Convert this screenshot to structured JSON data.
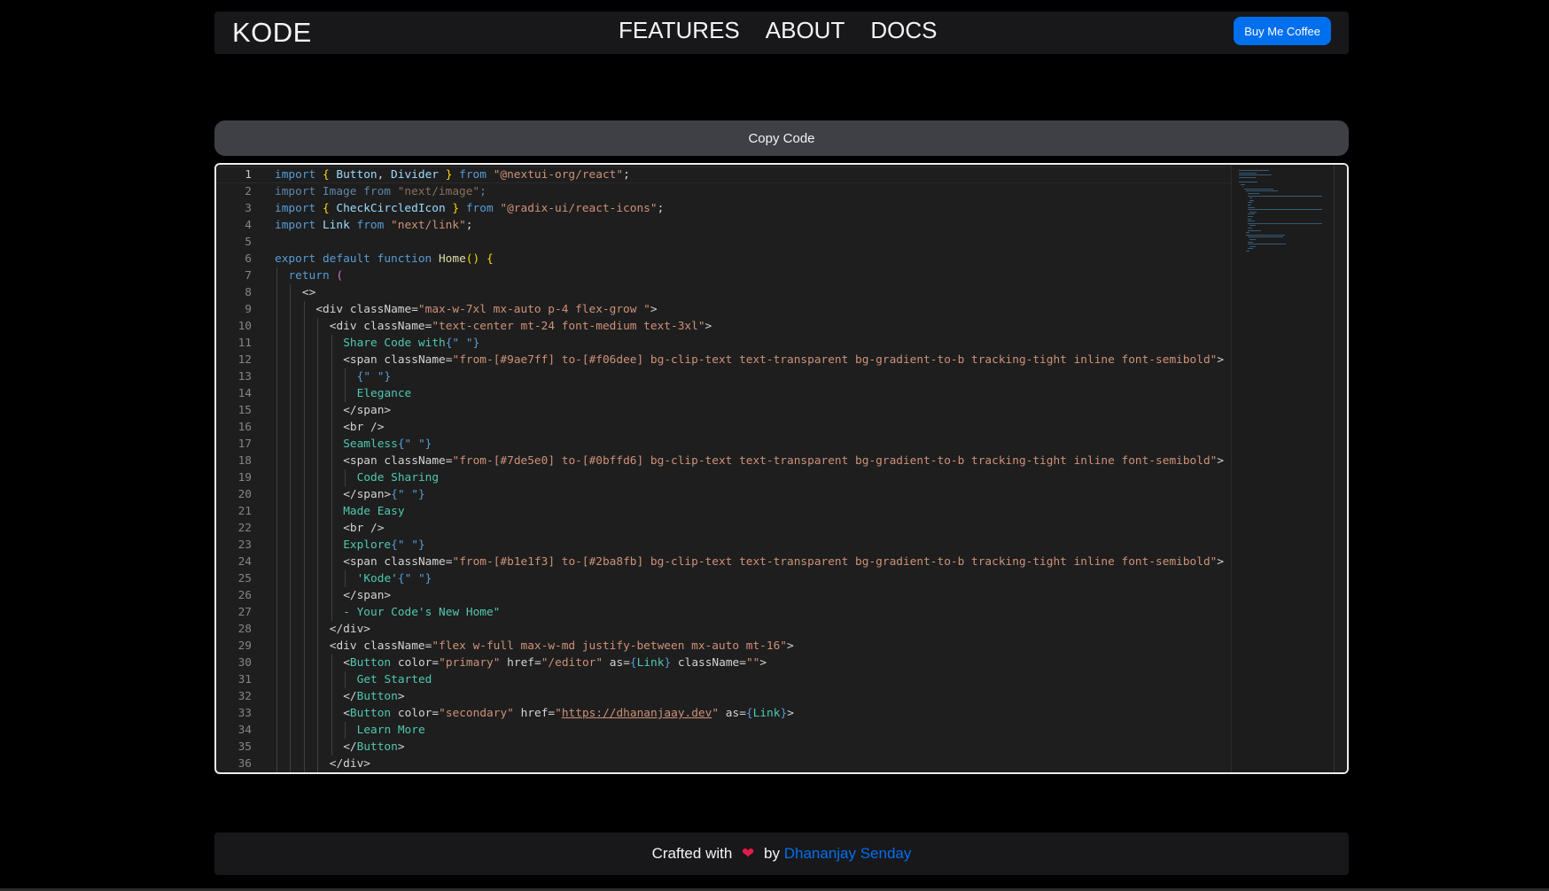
{
  "nav": {
    "logo": "KODE",
    "links": [
      "FEATURES",
      "ABOUT",
      "DOCS"
    ],
    "cta": "Buy Me Coffee"
  },
  "copy_button": "Copy Code",
  "editor": {
    "current_line": 1,
    "line_numbers": [
      "1",
      "2",
      "3",
      "4",
      "5",
      "6",
      "7",
      "8",
      "9",
      "10",
      "11",
      "12",
      "13",
      "14",
      "15",
      "16",
      "17",
      "18",
      "19",
      "20",
      "21",
      "22",
      "23",
      "24",
      "25",
      "26",
      "27",
      "28",
      "29",
      "30",
      "31",
      "32",
      "33",
      "34",
      "35",
      "36"
    ],
    "lines": [
      [
        [
          "kw",
          "import"
        ],
        [
          "def",
          " "
        ],
        [
          "br",
          "{"
        ],
        [
          "def",
          " "
        ],
        [
          "id",
          "Button"
        ],
        [
          "def",
          ", "
        ],
        [
          "id",
          "Divider"
        ],
        [
          "def",
          " "
        ],
        [
          "br",
          "}"
        ],
        [
          "def",
          " "
        ],
        [
          "kw",
          "from"
        ],
        [
          "def",
          " "
        ],
        [
          "str",
          "\"@nextui-org/react\""
        ],
        [
          "def",
          ";"
        ]
      ],
      [
        [
          "dim",
          "import Image from "
        ],
        [
          "dimstr",
          "\"next/image\""
        ],
        [
          "dim",
          ";"
        ]
      ],
      [
        [
          "kw",
          "import"
        ],
        [
          "def",
          " "
        ],
        [
          "br",
          "{"
        ],
        [
          "def",
          " "
        ],
        [
          "id",
          "CheckCircledIcon"
        ],
        [
          "def",
          " "
        ],
        [
          "br",
          "}"
        ],
        [
          "def",
          " "
        ],
        [
          "kw",
          "from"
        ],
        [
          "def",
          " "
        ],
        [
          "str",
          "\"@radix-ui/react-icons\""
        ],
        [
          "def",
          ";"
        ]
      ],
      [
        [
          "kw",
          "import"
        ],
        [
          "def",
          " "
        ],
        [
          "id",
          "Link"
        ],
        [
          "def",
          " "
        ],
        [
          "kw",
          "from"
        ],
        [
          "def",
          " "
        ],
        [
          "str",
          "\"next/link\""
        ],
        [
          "def",
          ";"
        ]
      ],
      [],
      [
        [
          "kw",
          "export"
        ],
        [
          "def",
          " "
        ],
        [
          "kw",
          "default"
        ],
        [
          "def",
          " "
        ],
        [
          "kw",
          "function"
        ],
        [
          "def",
          " "
        ],
        [
          "fn",
          "Home"
        ],
        [
          "br",
          "()"
        ],
        [
          "def",
          " "
        ],
        [
          "br",
          "{"
        ]
      ],
      [
        [
          "kw",
          "return"
        ],
        [
          "def",
          " "
        ],
        [
          "br2",
          "("
        ]
      ],
      [
        [
          "tag",
          "<>"
        ]
      ],
      [
        [
          "tag",
          "<div "
        ],
        [
          "attr",
          "className"
        ],
        [
          "def",
          "="
        ],
        [
          "str",
          "\"max-w-7xl mx-auto p-4 flex-grow \""
        ],
        [
          "tag",
          ">"
        ]
      ],
      [
        [
          "tag",
          "<div "
        ],
        [
          "attr",
          "className"
        ],
        [
          "def",
          "="
        ],
        [
          "str",
          "\"text-center mt-24 font-medium text-3xl\""
        ],
        [
          "tag",
          ">"
        ]
      ],
      [
        [
          "text",
          "Share Code with"
        ],
        [
          "expr",
          "{\" \"}"
        ]
      ],
      [
        [
          "tag",
          "<span "
        ],
        [
          "attr",
          "className"
        ],
        [
          "def",
          "="
        ],
        [
          "str",
          "\"from-[#9ae7ff] to-[#f06dee] bg-clip-text text-transparent bg-gradient-to-b tracking-tight inline font-semibold\""
        ],
        [
          "tag",
          ">"
        ]
      ],
      [
        [
          "expr",
          "{\" \"}"
        ]
      ],
      [
        [
          "text",
          "Elegance"
        ]
      ],
      [
        [
          "tag",
          "</span>"
        ]
      ],
      [
        [
          "tag",
          "<br />"
        ]
      ],
      [
        [
          "text",
          "Seamless"
        ],
        [
          "expr",
          "{\" \"}"
        ]
      ],
      [
        [
          "tag",
          "<span "
        ],
        [
          "attr",
          "className"
        ],
        [
          "def",
          "="
        ],
        [
          "str",
          "\"from-[#7de5e0] to-[#0bffd6] bg-clip-text text-transparent bg-gradient-to-b tracking-tight inline font-semibold\""
        ],
        [
          "tag",
          ">"
        ]
      ],
      [
        [
          "text",
          "Code Sharing"
        ]
      ],
      [
        [
          "tag",
          "</span>"
        ],
        [
          "expr",
          "{\" \"}"
        ]
      ],
      [
        [
          "text",
          "Made Easy"
        ]
      ],
      [
        [
          "tag",
          "<br />"
        ]
      ],
      [
        [
          "text",
          "Explore"
        ],
        [
          "expr",
          "{\" \"}"
        ]
      ],
      [
        [
          "tag",
          "<span "
        ],
        [
          "attr",
          "className"
        ],
        [
          "def",
          "="
        ],
        [
          "str",
          "\"from-[#b1e1f3] to-[#2ba8fb] bg-clip-text text-transparent bg-gradient-to-b tracking-tight inline font-semibold\""
        ],
        [
          "tag",
          ">"
        ]
      ],
      [
        [
          "text",
          "'Kode'"
        ],
        [
          "expr",
          "{\" \"}"
        ]
      ],
      [
        [
          "tag",
          "</span>"
        ]
      ],
      [
        [
          "text",
          "- Your Code's New Home\""
        ]
      ],
      [
        [
          "tag",
          "</div>"
        ]
      ],
      [
        [
          "tag",
          "<div "
        ],
        [
          "attr",
          "className"
        ],
        [
          "def",
          "="
        ],
        [
          "str",
          "\"flex w-full max-w-md justify-between mx-auto mt-16\""
        ],
        [
          "tag",
          ">"
        ]
      ],
      [
        [
          "tag",
          "<"
        ],
        [
          "comp",
          "Button"
        ],
        [
          "tag",
          " "
        ],
        [
          "attr",
          "color"
        ],
        [
          "def",
          "="
        ],
        [
          "str",
          "\"primary\""
        ],
        [
          "def",
          " "
        ],
        [
          "attr",
          "href"
        ],
        [
          "def",
          "="
        ],
        [
          "str",
          "\"/editor\""
        ],
        [
          "def",
          " "
        ],
        [
          "attr",
          "as"
        ],
        [
          "def",
          "="
        ],
        [
          "expr",
          "{"
        ],
        [
          "comp",
          "Link"
        ],
        [
          "expr",
          "}"
        ],
        [
          "def",
          " "
        ],
        [
          "attr",
          "className"
        ],
        [
          "def",
          "="
        ],
        [
          "str",
          "\"\""
        ],
        [
          "tag",
          ">"
        ]
      ],
      [
        [
          "text",
          "Get Started"
        ]
      ],
      [
        [
          "tag",
          "</"
        ],
        [
          "comp",
          "Button"
        ],
        [
          "tag",
          ">"
        ]
      ],
      [
        [
          "tag",
          "<"
        ],
        [
          "comp",
          "Button"
        ],
        [
          "tag",
          " "
        ],
        [
          "attr",
          "color"
        ],
        [
          "def",
          "="
        ],
        [
          "str",
          "\"secondary\""
        ],
        [
          "def",
          " "
        ],
        [
          "attr",
          "href"
        ],
        [
          "def",
          "="
        ],
        [
          "str",
          "\""
        ],
        [
          "link",
          "https://dhananjaay.dev"
        ],
        [
          "str",
          "\""
        ],
        [
          "def",
          " "
        ],
        [
          "attr",
          "as"
        ],
        [
          "def",
          "="
        ],
        [
          "expr",
          "{"
        ],
        [
          "comp",
          "Link"
        ],
        [
          "expr",
          "}"
        ],
        [
          "tag",
          ">"
        ]
      ],
      [
        [
          "text",
          "Learn More"
        ]
      ],
      [
        [
          "tag",
          "</"
        ],
        [
          "comp",
          "Button"
        ],
        [
          "tag",
          ">"
        ]
      ],
      [
        [
          "tag",
          "</div>"
        ]
      ]
    ]
  },
  "footer": {
    "prefix": "Crafted with",
    "heart": "❤",
    "by": "by",
    "author": "Dhananjay Senday"
  },
  "colors": {
    "accent": "#006fee",
    "background": "#000000",
    "panel": "#18181b",
    "editor_bg": "#1e1e1e"
  }
}
